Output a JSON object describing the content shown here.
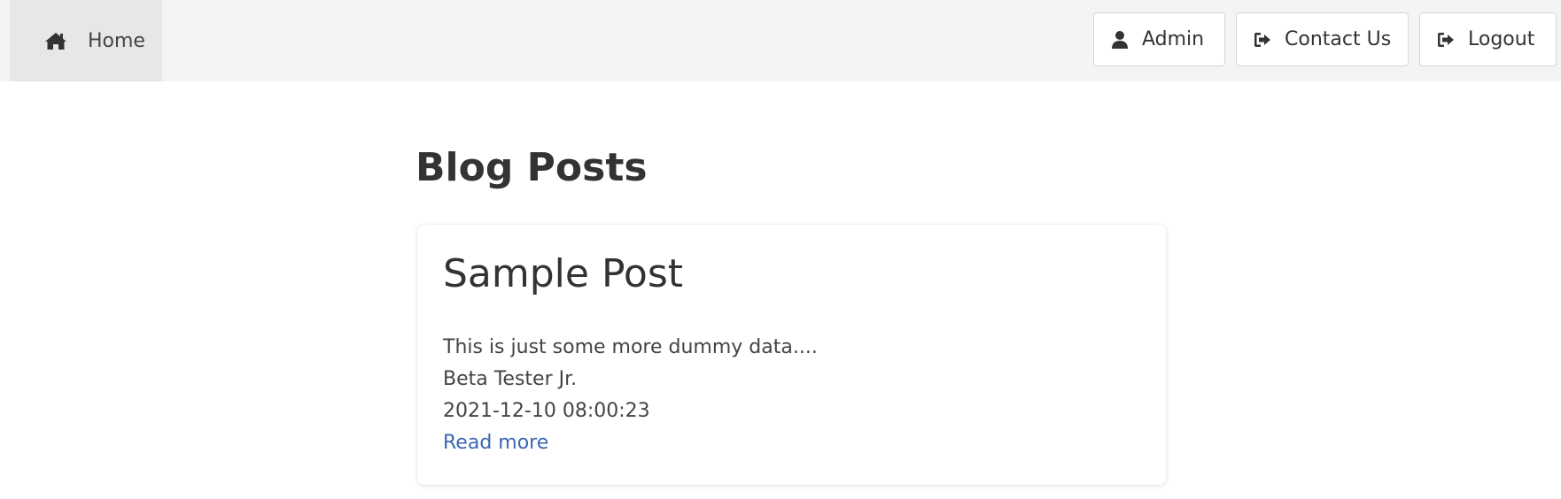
{
  "navbar": {
    "home_label": "Home",
    "admin_label": "Admin",
    "contact_label": "Contact Us",
    "logout_label": "Logout"
  },
  "main": {
    "title": "Blog Posts",
    "posts": [
      {
        "title": "Sample Post",
        "body": "This is just some more dummy data....",
        "author": "Beta Tester Jr.",
        "date": "2021-12-10 08:00:23",
        "link_label": "Read more"
      }
    ]
  },
  "icons": {
    "home": "home-icon",
    "admin": "user-icon",
    "contact": "sign-out-icon",
    "logout": "sign-out-icon"
  },
  "colors": {
    "navbar_bg": "#f4f4f4",
    "home_active_bg": "#e7e7e7",
    "link": "#3b66b0",
    "text": "#333333"
  }
}
